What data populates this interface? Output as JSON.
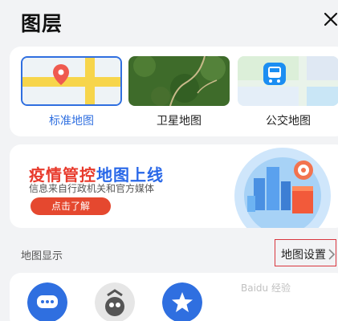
{
  "header": {
    "title": "图层"
  },
  "layers": [
    {
      "label": "标准地图",
      "selected": true
    },
    {
      "label": "卫星地图",
      "selected": false
    },
    {
      "label": "公交地图",
      "selected": false
    }
  ],
  "banner": {
    "title_red": "疫情管控",
    "title_blue": "地图上线",
    "subtitle": "信息来自行政机关和官方媒体",
    "button_label": "点击了解"
  },
  "map_display": {
    "section_title": "地图显示",
    "settings_label": "地图设置"
  },
  "watermark": "Baidu 经验",
  "colors": {
    "accent": "#2f6fe0",
    "banner_red": "#e83a2c",
    "banner_blue": "#2867e8",
    "highlight_box": "#d9363e"
  }
}
